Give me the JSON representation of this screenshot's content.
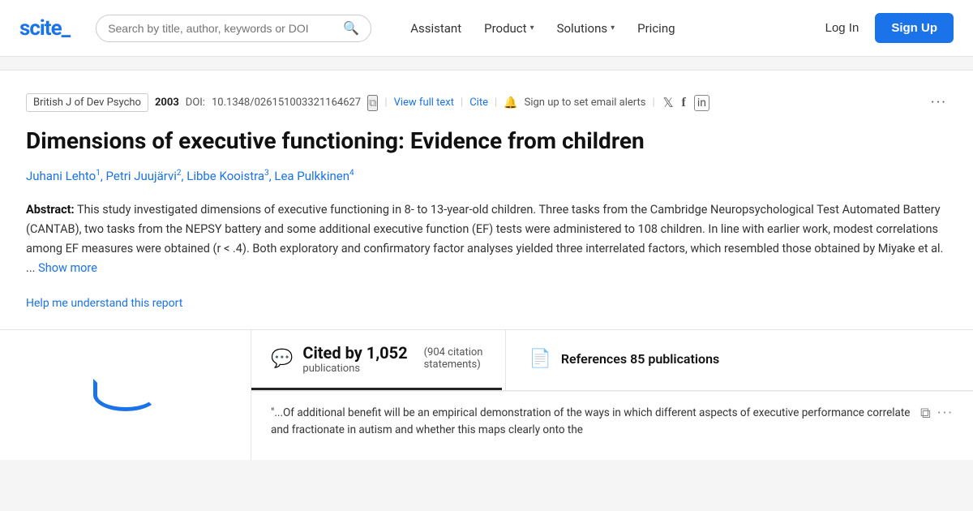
{
  "logo": {
    "text": "scite_"
  },
  "navbar": {
    "search_placeholder": "Search by title, author, keywords or DOI",
    "assistant_label": "Assistant",
    "product_label": "Product",
    "solutions_label": "Solutions",
    "pricing_label": "Pricing",
    "login_label": "Log In",
    "signup_label": "Sign Up"
  },
  "article": {
    "journal": "British J of Dev Psycho",
    "year": "2003",
    "doi_label": "DOI:",
    "doi": "10.1348/026151003321164627",
    "view_full_text": "View full text",
    "cite": "Cite",
    "alert_text": "Sign up to set email alerts",
    "title": "Dimensions of executive functioning: Evidence from children",
    "authors": [
      {
        "name": "Juhani Lehto",
        "sup": "1"
      },
      {
        "name": "Petri Juujärvi",
        "sup": "2"
      },
      {
        "name": "Libbe Kooistra",
        "sup": "3"
      },
      {
        "name": "Lea Pulkkinen",
        "sup": "4"
      }
    ],
    "abstract_label": "Abstract:",
    "abstract_text": "This study investigated dimensions of executive functioning in 8- to 13-year-old children. Three tasks from the Cambridge Neuropsychological Test Automated Battery (CANTAB), two tasks from the NEPSY battery and some additional executive function (EF) tests were administered to 108 children. In line with earlier work, modest correlations among EF measures were obtained (r < .4). Both exploratory and confirmatory factor analyses yielded three interrelated factors, which resembled those obtained by Miyake et al. ...",
    "show_more": "Show more",
    "help_link": "Help me understand this report"
  },
  "citations": {
    "cited_by_label": "Cited by 1,052",
    "cited_by_sub": "publications",
    "citation_statements": "(904 citation\nstatements)",
    "references_label": "References 85 publications"
  },
  "quote": {
    "text": "\"...Of additional benefit will be an empirical demonstration of the ways in which different aspects of executive performance correlate and fractionate in autism and whether this maps clearly onto the"
  },
  "icons": {
    "search": "🔍",
    "bell": "🔔",
    "twitter": "𝕏",
    "facebook": "f",
    "linkedin": "in",
    "more_dots": "···",
    "speech_bubble": "💬",
    "document": "📄",
    "copy": "⧉",
    "chevron_down": "▾"
  }
}
